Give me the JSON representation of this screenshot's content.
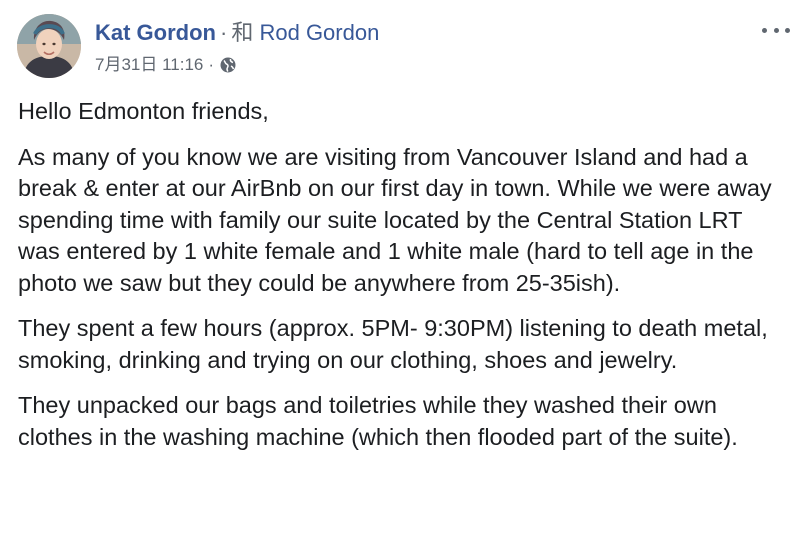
{
  "post": {
    "author": "Kat Gordon",
    "separator": "·",
    "with_word": "和",
    "tagged_person": "Rod Gordon",
    "timestamp": "7月31日 11:16",
    "meta_separator": "·",
    "audience_icon": "globe-icon",
    "more_icon": "more-options-icon",
    "paragraphs": [
      "Hello Edmonton friends,",
      "As many of you know we are visiting from Vancouver Island and had a break & enter at our AirBnb on our first day in town. While we were away spending time with family our suite located by the Central Station LRT was entered by 1 white female and 1 white male (hard to tell age in the photo we saw but they could be anywhere from 25-35ish).",
      "They spent a few hours (approx. 5PM- 9:30PM) listening to death metal, smoking, drinking and trying on our clothing, shoes and jewelry.",
      "They unpacked our bags and toiletries while they washed their own clothes in the washing machine (which then flooded part of the suite)."
    ]
  },
  "colors": {
    "link": "#385898",
    "secondary_text": "#606770",
    "primary_text": "#1c1e21"
  }
}
